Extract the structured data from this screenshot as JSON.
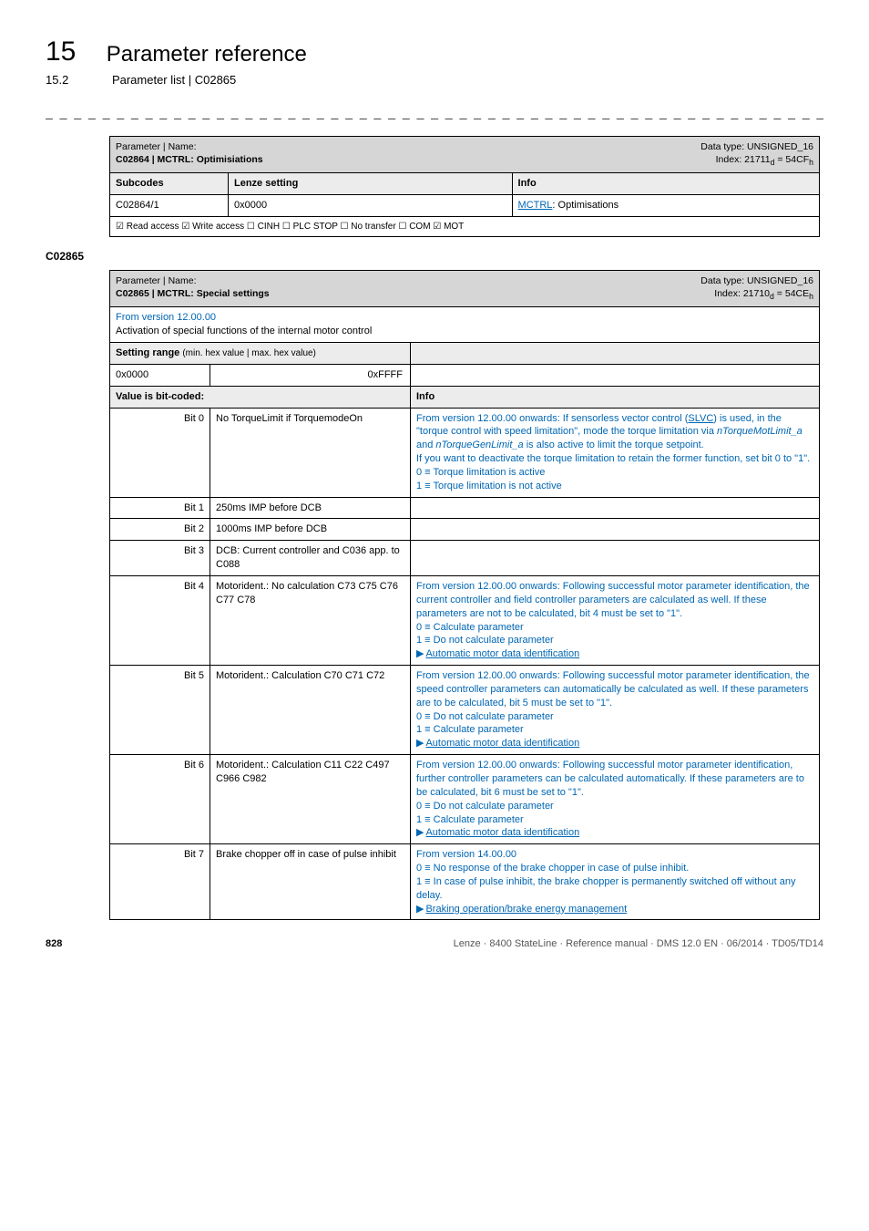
{
  "header": {
    "chapter_num": "15",
    "chapter_title": "Parameter reference",
    "subsection_num": "15.2",
    "subsection_title": "Parameter list | C02865",
    "dash_rule": "_ _ _ _ _ _ _ _ _ _ _ _ _ _ _ _ _ _ _ _ _ _ _ _ _ _ _ _ _ _ _ _ _ _ _ _ _ _ _ _ _ _ _ _ _ _ _ _ _ _ _ _ _ _ _ _ _ _ _ _ _"
  },
  "table1": {
    "param_label": "Parameter | Name:",
    "param_value": "C02864 | MCTRL: Optimisiations",
    "datatype_label": "Data type: UNSIGNED_16",
    "index_label": "Index: 21711",
    "index_sub_d": "d",
    "index_eq": " = 54CF",
    "index_sub_h": "h",
    "col1": "Subcodes",
    "col2": "Lenze setting",
    "col3": "Info",
    "row1_c1": "C02864/1",
    "row1_c2": "0x0000",
    "row1_c3_link": "MCTRL",
    "row1_c3_rest": ": Optimisations",
    "access": "☑ Read access   ☑ Write access   ☐ CINH   ☐ PLC STOP   ☐ No transfer   ☐ COM   ☑ MOT"
  },
  "section_label": "C02865",
  "table2": {
    "param_label": "Parameter | Name:",
    "param_value": "C02865 | MCTRL: Special settings",
    "datatype_label": "Data type: UNSIGNED_16",
    "index_label": "Index: 21710",
    "index_sub_d": "d",
    "index_eq": " = 54CE",
    "index_sub_h": "h",
    "from_version": "From version 12.00.00",
    "activation": "Activation of special functions of the internal motor control",
    "setting_range": "Setting range (min. hex value | max. hex value)",
    "sr_min": "0x0000",
    "sr_max": "0xFFFF",
    "val_bitcoded": "Value is bit-coded:",
    "info_hdr": "Info",
    "bits": [
      {
        "bit": "Bit 0",
        "desc": "No TorqueLimit if TorquemodeOn",
        "info_pre_link": "From version 12.00.00 onwards:",
        "info_after_colon": " If sensorless vector control (",
        "slvc": "SLVC",
        "info_after_slvc": ") is used, in the \"torque control with speed limitation\", mode the torque limitation via ",
        "italic1": "nTorqueMotLimit_a",
        "mid1": " and ",
        "italic2": "nTorqueGenLimit_a",
        "mid2": " is also active to limit the torque setpoint.",
        "line2": "If you want to deactivate the torque limitation to retain the former function, set bit 0 to \"1\".",
        "line3": "0 ≡ Torque limitation is active",
        "line4": "1 ≡ Torque limitation is not active"
      },
      {
        "bit": "Bit 1",
        "desc": "250ms IMP before DCB",
        "info": ""
      },
      {
        "bit": "Bit 2",
        "desc": "1000ms IMP before DCB",
        "info": ""
      },
      {
        "bit": "Bit 3",
        "desc": "DCB: Current controller and C036 app. to C088",
        "info": ""
      },
      {
        "bit": "Bit 4",
        "desc": "Motorident.: No calculation C73 C75 C76 C77 C78",
        "info_pre": "From version 12.00.00 onwards:",
        "info_rest": " Following successful motor parameter identification, the current controller and field controller parameters are calculated as well. If these parameters are not to be calculated, bit 4 must be set to \"1\".",
        "l1": "0 ≡ Calculate parameter",
        "l2": "1 ≡ Do not calculate parameter",
        "link": "Automatic motor data identification"
      },
      {
        "bit": "Bit 5",
        "desc": "Motorident.: Calculation C70 C71 C72",
        "info_pre": "From version 12.00.00 onwards:",
        "info_rest": " Following successful motor parameter identification, the speed controller parameters can automatically be calculated as well. If these parameters are to be calculated, bit 5 must be set to \"1\".",
        "l1": "0 ≡ Do not calculate parameter",
        "l2": "1 ≡ Calculate parameter",
        "link": "Automatic motor data identification"
      },
      {
        "bit": "Bit 6",
        "desc": "Motorident.: Calculation C11 C22 C497 C966 C982",
        "info_pre": "From version 12.00.00 onwards:",
        "info_rest": " Following successful motor parameter identification, further controller parameters can be calculated automatically. If these parameters are to be calculated, bit 6 must be set to \"1\".",
        "l1": "0 ≡ Do not calculate parameter",
        "l2": "1 ≡ Calculate parameter",
        "link": "Automatic motor data identification"
      },
      {
        "bit": "Bit 7",
        "desc": "Brake chopper off in case of pulse inhibit",
        "info_pre": "From version 14.00.00",
        "l0": "0 ≡ No response of the brake chopper in case of pulse inhibit.",
        "l1": "1 ≡ In case of pulse inhibit, the brake chopper is permanently switched off without any delay.",
        "link": "Braking operation/brake energy management"
      }
    ]
  },
  "footer": {
    "page": "828",
    "right": "Lenze · 8400 StateLine · Reference manual · DMS 12.0 EN · 06/2014 · TD05/TD14"
  }
}
